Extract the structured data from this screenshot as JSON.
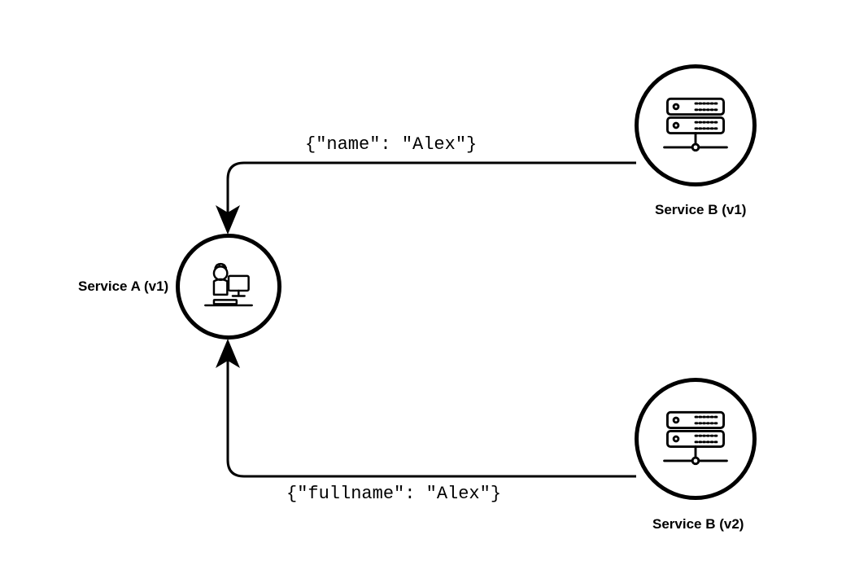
{
  "nodes": {
    "serviceA": {
      "label": "Service A (v1)"
    },
    "serviceB_v1": {
      "label": "Service B (v1)"
    },
    "serviceB_v2": {
      "label": "Service B (v2)"
    }
  },
  "edges": {
    "top": {
      "payload": "{\"name\": \"Alex\"}"
    },
    "bottom": {
      "payload": "{\"fullname\": \"Alex\"}"
    }
  }
}
